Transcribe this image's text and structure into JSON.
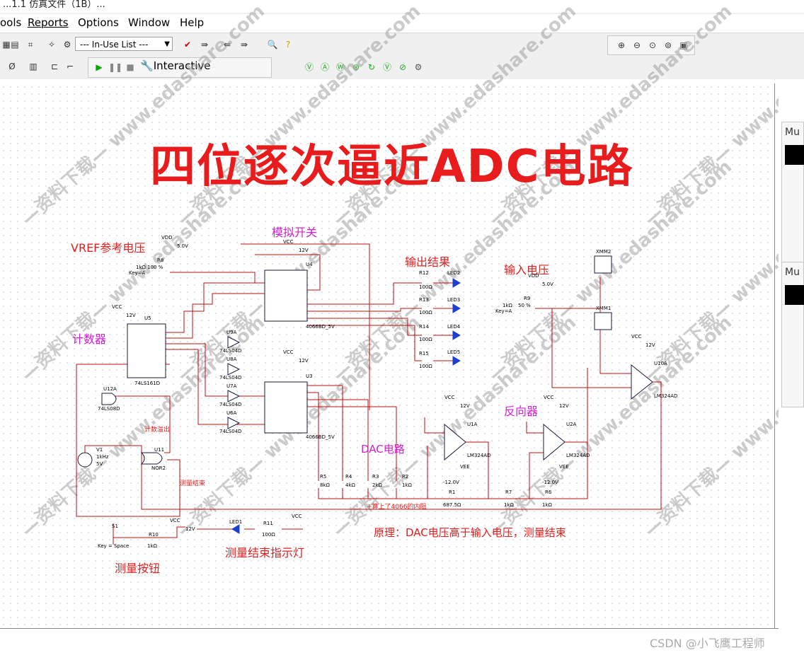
{
  "window": {
    "title": "...1.1 仿真文件（1B）..."
  },
  "menu": [
    {
      "label": "ools",
      "ul": ""
    },
    {
      "label": "Reports",
      "ul": "R"
    },
    {
      "label": "Options",
      "ul": "O"
    },
    {
      "label": "Window",
      "ul": "W"
    },
    {
      "label": "Help",
      "ul": "H"
    }
  ],
  "toolbar": {
    "in_use_list": "--- In-Use List ---",
    "interactive": "Interactive"
  },
  "schematic": {
    "title": "四位逐次逼近ADC电路",
    "labels": {
      "vref": "VREF参考电压",
      "analog_switch": "模拟开关",
      "output_result": "输出结果",
      "input_voltage": "输入电压",
      "counter": "计数器",
      "inverter": "反向器",
      "dac": "DAC电路",
      "count_overflow": "计数溢出",
      "measure_end_small": "测量结束",
      "note_4066": "+算上了4066的内阻",
      "principle": "原理：DAC电压高于输入电压，测量结束",
      "measure_button": "测量按钮",
      "measure_led": "测量结束指示灯"
    },
    "parts": {
      "vdd": "VDD",
      "vcc": "VCC",
      "vee": "VEE",
      "v5": "5.0V",
      "v12": "12V",
      "vm12": "-12.0V",
      "r8": "R8",
      "r8_val": "1kΩ 100 %",
      "key_a": "Key=A",
      "r9": "R9",
      "r9_pct": "50 %",
      "r9_val": "1kΩ",
      "u4": "U4",
      "u3": "U3",
      "u5": "U5",
      "ic4066": "4066BD_5V",
      "ic74161": "74LS161D",
      "u8a": "U8A",
      "u7a": "U7A",
      "u6a": "U6A",
      "u9a": "U9A",
      "ls04": "74LS04D",
      "u12a": "U12A",
      "ls08": "74LS08D",
      "u11": "U11",
      "nor2": "NOR2",
      "v1": "V1",
      "v1_f": "1kHz",
      "v1_v": "5V",
      "r12": "R12",
      "r13": "R13",
      "r14": "R14",
      "r15": "R15",
      "r100": "100Ω",
      "led2": "LED2",
      "led3": "LED3",
      "led4": "LED4",
      "led5": "LED5",
      "led1": "LED1",
      "xmm1": "XMM1",
      "xmm2": "XMM2",
      "u10a": "U10A",
      "u1a": "U1A",
      "u2a": "U2A",
      "lm324": "LM324AD",
      "r5": "R5",
      "r5_val": "8kΩ",
      "r4": "R4",
      "r4_val": "4kΩ",
      "r3": "R3",
      "r3_val": "2kΩ",
      "r2": "R2",
      "r2_val": "1kΩ",
      "r1": "R1",
      "r1_val": "687.5Ω",
      "r7": "R7",
      "r7_val": "1kΩ",
      "r6": "R6",
      "r6_val": "1kΩ",
      "s1": "S1",
      "key_space": "Key = Space",
      "r10": "R10",
      "r10_val": "1kΩ",
      "r11": "R11",
      "r11_val": "100Ω"
    },
    "watermark": "—资料下载— www.edashare.com"
  },
  "side_panels": [
    {
      "label": "Mu"
    },
    {
      "label": "Mu"
    }
  ],
  "footer": {
    "csdn": "CSDN @小飞鹰工程师"
  }
}
